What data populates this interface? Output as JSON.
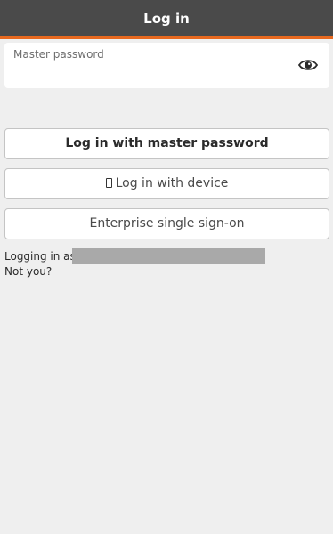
{
  "header": {
    "title": "Log in"
  },
  "password_field": {
    "label": "Master password",
    "value": "",
    "toggle_icon": "eye-icon"
  },
  "buttons": {
    "master_password": "Log in with master password",
    "device_icon": "mobile-device-icon",
    "device": "Log in with device",
    "sso": "Enterprise single sign-on"
  },
  "account": {
    "logging_in_as": "Logging in as",
    "not_you": "Not you?"
  },
  "colors": {
    "header_bg": "#4a4a4a",
    "accent": "#e8691f",
    "page_bg": "#efefef"
  }
}
